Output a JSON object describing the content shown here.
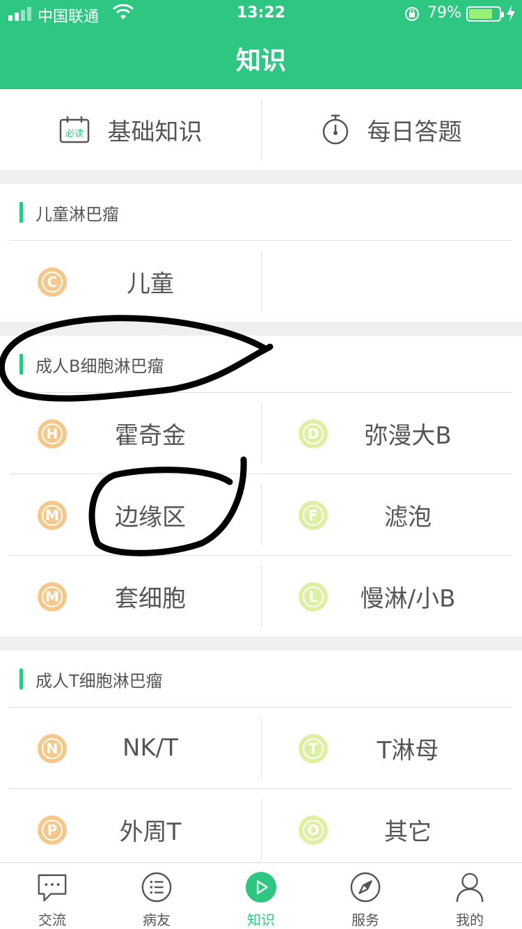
{
  "status_bar": {
    "carrier": "中国联通",
    "time": "13:22",
    "battery_percent": "79%",
    "battery_level": 0.79
  },
  "header": {
    "title": "知识"
  },
  "top_actions": [
    {
      "label": "基础知识",
      "icon": "calendar-must-read-icon",
      "icon_text": "必读"
    },
    {
      "label": "每日答题",
      "icon": "stopwatch-icon"
    }
  ],
  "sections": [
    {
      "title": "儿童淋巴瘤",
      "items": [
        {
          "letter": "C",
          "label": "儿童",
          "color": "#f5c88a"
        }
      ]
    },
    {
      "title": "成人B细胞淋巴瘤",
      "items": [
        {
          "letter": "H",
          "label": "霍奇金",
          "color": "#f5c88a"
        },
        {
          "letter": "D",
          "label": "弥漫大B",
          "color": "#ddf0a2"
        },
        {
          "letter": "M",
          "label": "边缘区",
          "color": "#f5c88a"
        },
        {
          "letter": "F",
          "label": "滤泡",
          "color": "#ddf0a2"
        },
        {
          "letter": "M",
          "label": "套细胞",
          "color": "#f5c88a"
        },
        {
          "letter": "L",
          "label": "慢淋/小B",
          "color": "#ddf0a2"
        }
      ]
    },
    {
      "title": "成人T细胞淋巴瘤",
      "items": [
        {
          "letter": "N",
          "label": "NK/T",
          "color": "#f5c88a"
        },
        {
          "letter": "T",
          "label": "T淋母",
          "color": "#ddf0a2"
        },
        {
          "letter": "P",
          "label": "外周T",
          "color": "#f5c88a"
        },
        {
          "letter": "O",
          "label": "其它",
          "color": "#ddf0a2"
        }
      ]
    }
  ],
  "tabbar": [
    {
      "label": "交流",
      "icon": "chat-bubble-icon"
    },
    {
      "label": "病友",
      "icon": "list-icon"
    },
    {
      "label": "知识",
      "icon": "play-icon",
      "active": true
    },
    {
      "label": "服务",
      "icon": "compass-icon"
    },
    {
      "label": "我的",
      "icon": "person-icon"
    }
  ],
  "colors": {
    "brand": "#2ec782",
    "badge_orange": "#f5c88a",
    "badge_green": "#ddf0a2",
    "annotation": "#000000"
  }
}
